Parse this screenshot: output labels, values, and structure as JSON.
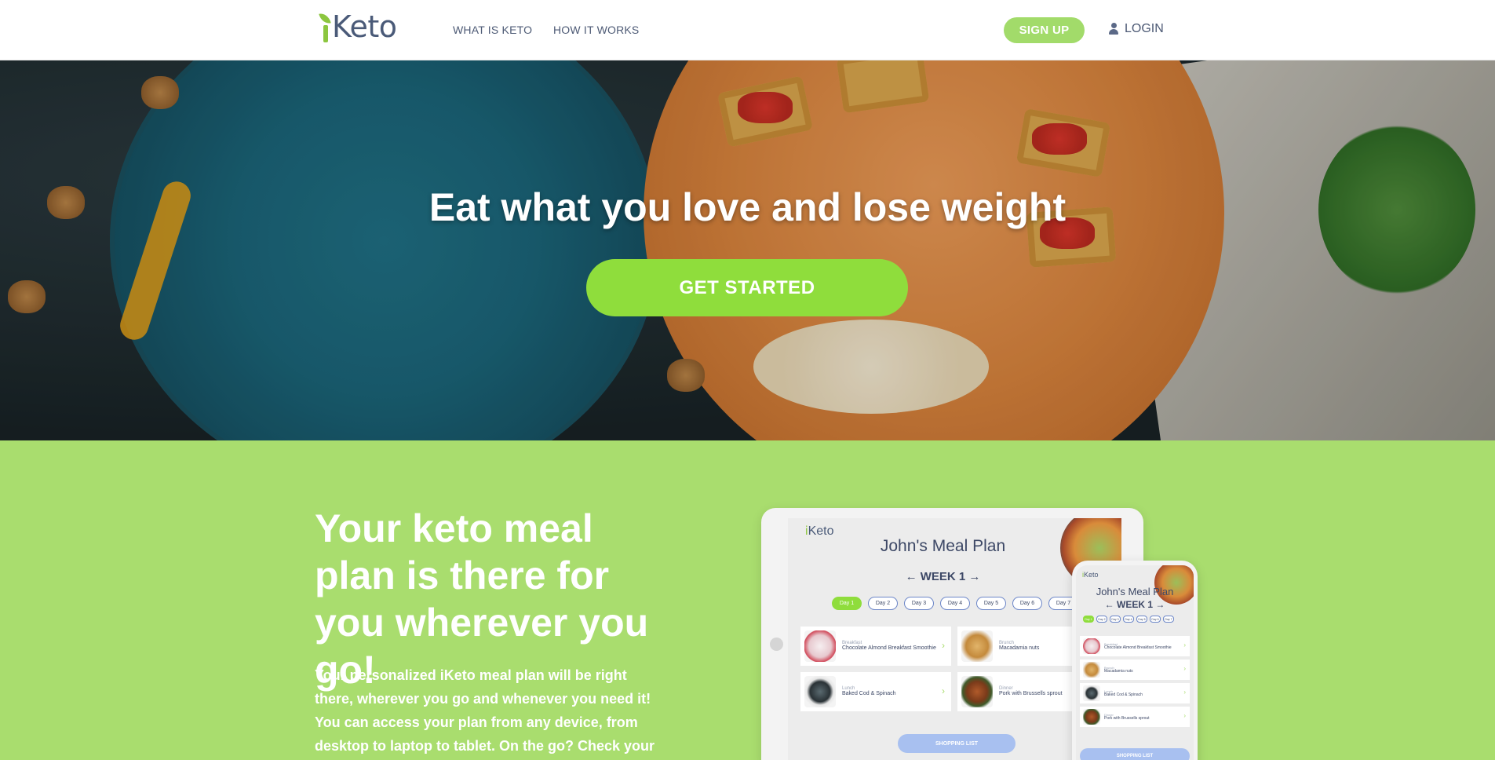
{
  "header": {
    "logo": "iKeto",
    "nav": [
      {
        "label": "WHAT IS KETO"
      },
      {
        "label": "HOW IT WORKS"
      }
    ],
    "signup_label": "SIGN UP",
    "login_label": "LOGIN"
  },
  "hero": {
    "title": "Eat what you love and lose weight",
    "cta_label": "GET STARTED"
  },
  "mealplan_section": {
    "title": "Your keto meal plan is there for you wherever you go!",
    "text": "Your personalized iKeto meal plan will be right there, wherever you go and whenever you need it! You can access your plan from any device, from desktop to laptop to tablet. On the go? Check your meal plan or"
  },
  "tablet": {
    "logo": "Keto",
    "title": "John's Meal Plan",
    "week": "← WEEK 1 →",
    "days": [
      "Day 1",
      "Day 2",
      "Day 3",
      "Day 4",
      "Day 5",
      "Day 6",
      "Day 7"
    ],
    "cards": [
      {
        "meal": "Breakfast",
        "dish": "Chocolate Almond Breakfast Smoothie"
      },
      {
        "meal": "Brunch",
        "dish": "Macadamia nuts"
      },
      {
        "meal": "Lunch",
        "dish": "Baked Cod & Spinach"
      },
      {
        "meal": "Dinner",
        "dish": "Pork with Brussells sprout"
      }
    ],
    "shopping_label": "SHOPPING LIST"
  },
  "phone": {
    "logo": "Keto",
    "title": "John's Meal Plan",
    "week": "← WEEK 1 →",
    "days": [
      "Day 1",
      "Day 2",
      "Day 3",
      "Day 4",
      "Day 5",
      "Day 6",
      "Day 7"
    ],
    "cards": [
      {
        "meal": "Breakfast",
        "dish": "Chocolate Almond Breakfast Smoothie"
      },
      {
        "meal": "Brunch",
        "dish": "Macadamia nuts"
      },
      {
        "meal": "Lunch",
        "dish": "Baked Cod & Spinach"
      },
      {
        "meal": "Dinner",
        "dish": "Pork with Brussells sprout"
      }
    ],
    "shopping_label": "SHOPPING LIST"
  },
  "colors": {
    "brand_green": "#a9dd6e",
    "cta_green": "#8fdd3c",
    "nav_text": "#4d5a75"
  }
}
